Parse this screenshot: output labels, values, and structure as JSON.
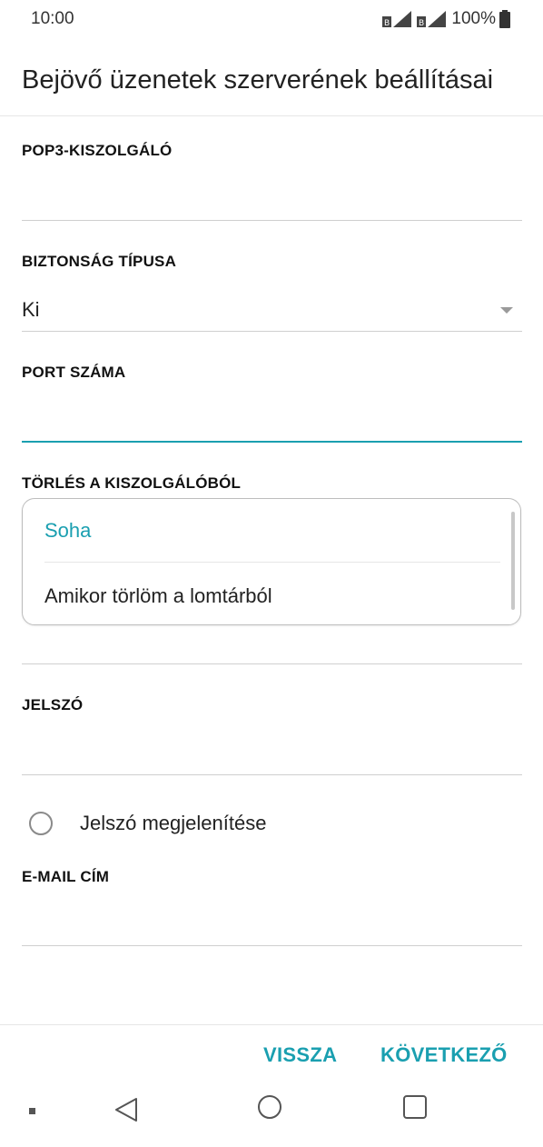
{
  "status_bar": {
    "time": "10:00",
    "battery": "100%"
  },
  "page": {
    "title": "Bejövő üzenetek szerverének beállításai"
  },
  "fields": {
    "server_label": "POP3-KISZOLGÁLÓ",
    "security_label": "BIZTONSÁG TÍPUSA",
    "security_value": "Ki",
    "port_label": "PORT SZÁMA",
    "delete_label": "TÖRLÉS A KISZOLGÁLÓBÓL",
    "password_label": "JELSZÓ",
    "show_password_label": "Jelszó megjelenítése",
    "email_label": "E-MAIL CÍM"
  },
  "dropdown": {
    "options": [
      "Soha",
      "Amikor törlöm a lomtárból"
    ],
    "selected_color": "#1a9fb0"
  },
  "buttons": {
    "back": "VISSZA",
    "next": "KÖVETKEZŐ"
  },
  "colors": {
    "accent": "#1a9fb0"
  }
}
